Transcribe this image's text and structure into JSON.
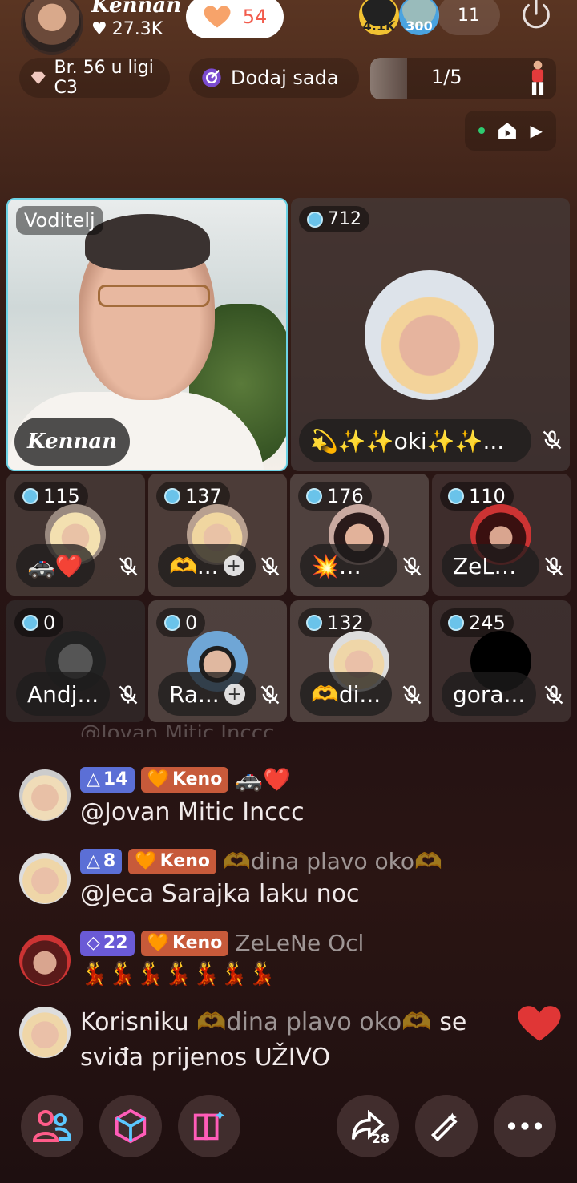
{
  "header": {
    "host_name": "Kennan",
    "host_likes": "27.3K",
    "heart_count": "54",
    "top_badge_1": "4.1K",
    "top_badge_2": "300",
    "viewers": "11",
    "rank_label": "Br. 56 u ligi C3",
    "add_label": "Dodaj sada",
    "progress": "1/5",
    "progress_fraction": 0.2
  },
  "grid": {
    "host_label": "Voditelj",
    "host_name": "Kennan",
    "guest_main": {
      "score": "712",
      "name": "💫✨✨oki✨✨..."
    },
    "guests": [
      {
        "score": "115",
        "name": "🚓❤️"
      },
      {
        "score": "137",
        "name": "🫶..."
      },
      {
        "score": "176",
        "name": "💥💔..."
      },
      {
        "score": "110",
        "name": "ZeLe..."
      },
      {
        "score": "0",
        "name": "Andj..."
      },
      {
        "score": "0",
        "name": "Ra..."
      },
      {
        "score": "132",
        "name": "🫶di..."
      },
      {
        "score": "245",
        "name": "gora..."
      }
    ]
  },
  "chat": [
    {
      "level": "14",
      "fan": "Keno",
      "user": "🚓❤️",
      "text": "@Jovan Mitic Inccc"
    },
    {
      "level": "8",
      "fan": "Keno",
      "user": "🫶dina plavo oko🫶",
      "text": "@Jeca Sarajka laku noc"
    },
    {
      "level": "22",
      "fan": "Keno",
      "user": "ZeLeNe Ocl",
      "text": "💃💃💃💃💃💃💃"
    }
  ],
  "system_msg": {
    "prefix": "Korisniku",
    "user": "🫶dina plavo oko🫶",
    "suffix": "se",
    "line2": "sviđa prijenos UŽIVO"
  },
  "bottom": {
    "share_count": "28"
  },
  "colors": {
    "accent_cyan": "#6dd3e6",
    "level_badge": "#5b6fd6",
    "fan_badge": "#c75a3a",
    "heart": "#f25b4c"
  }
}
